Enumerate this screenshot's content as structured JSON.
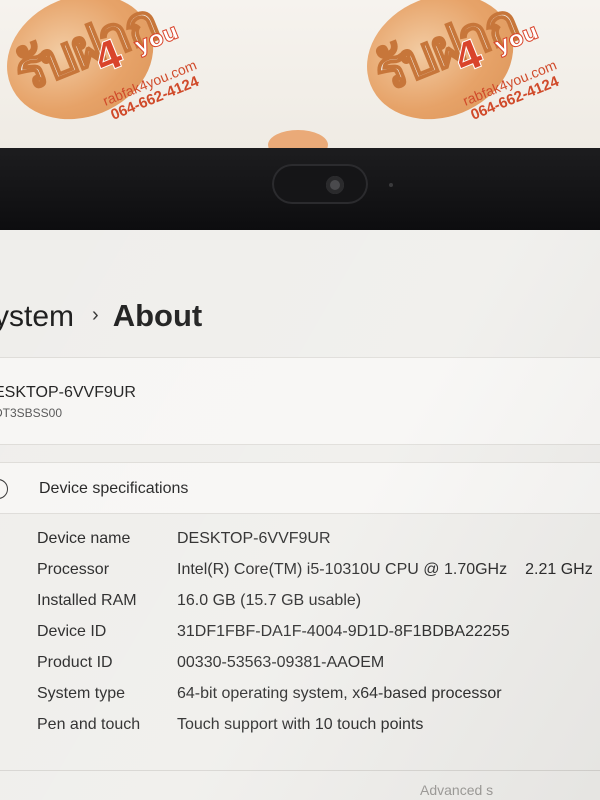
{
  "watermark": {
    "brand_thai": "รับฝาก",
    "brand_number": "4",
    "brand_suffix": "you",
    "url": "rabfak4you.com",
    "phone": "064-662-4124"
  },
  "header": {
    "breadcrumb_parent": "ystem",
    "breadcrumb_separator": "›",
    "breadcrumb_current": "About"
  },
  "device": {
    "hostname": "ESKTOP-6VVF9UR",
    "model": "DT3SBSS00"
  },
  "specs": {
    "section_title": "Device specifications",
    "info_glyph": "i",
    "rows": [
      {
        "label": "Device name",
        "value": "DESKTOP-6VVF9UR",
        "extra": ""
      },
      {
        "label": "Processor",
        "value": "Intel(R) Core(TM) i5-10310U CPU @ 1.70GHz",
        "extra": "2.21 GHz"
      },
      {
        "label": "Installed RAM",
        "value": "16.0 GB (15.7 GB usable)",
        "extra": ""
      },
      {
        "label": "Device ID",
        "value": "31DF1FBF-DA1F-4004-9D1D-8F1BDBA22255",
        "extra": ""
      },
      {
        "label": "Product ID",
        "value": "00330-53563-09381-AAOEM",
        "extra": ""
      },
      {
        "label": "System type",
        "value": "64-bit operating system, x64-based processor",
        "extra": ""
      },
      {
        "label": "Pen and touch",
        "value": "Touch support with 10 touch points",
        "extra": ""
      }
    ]
  },
  "footer": {
    "partial_text": "Advanced s"
  }
}
